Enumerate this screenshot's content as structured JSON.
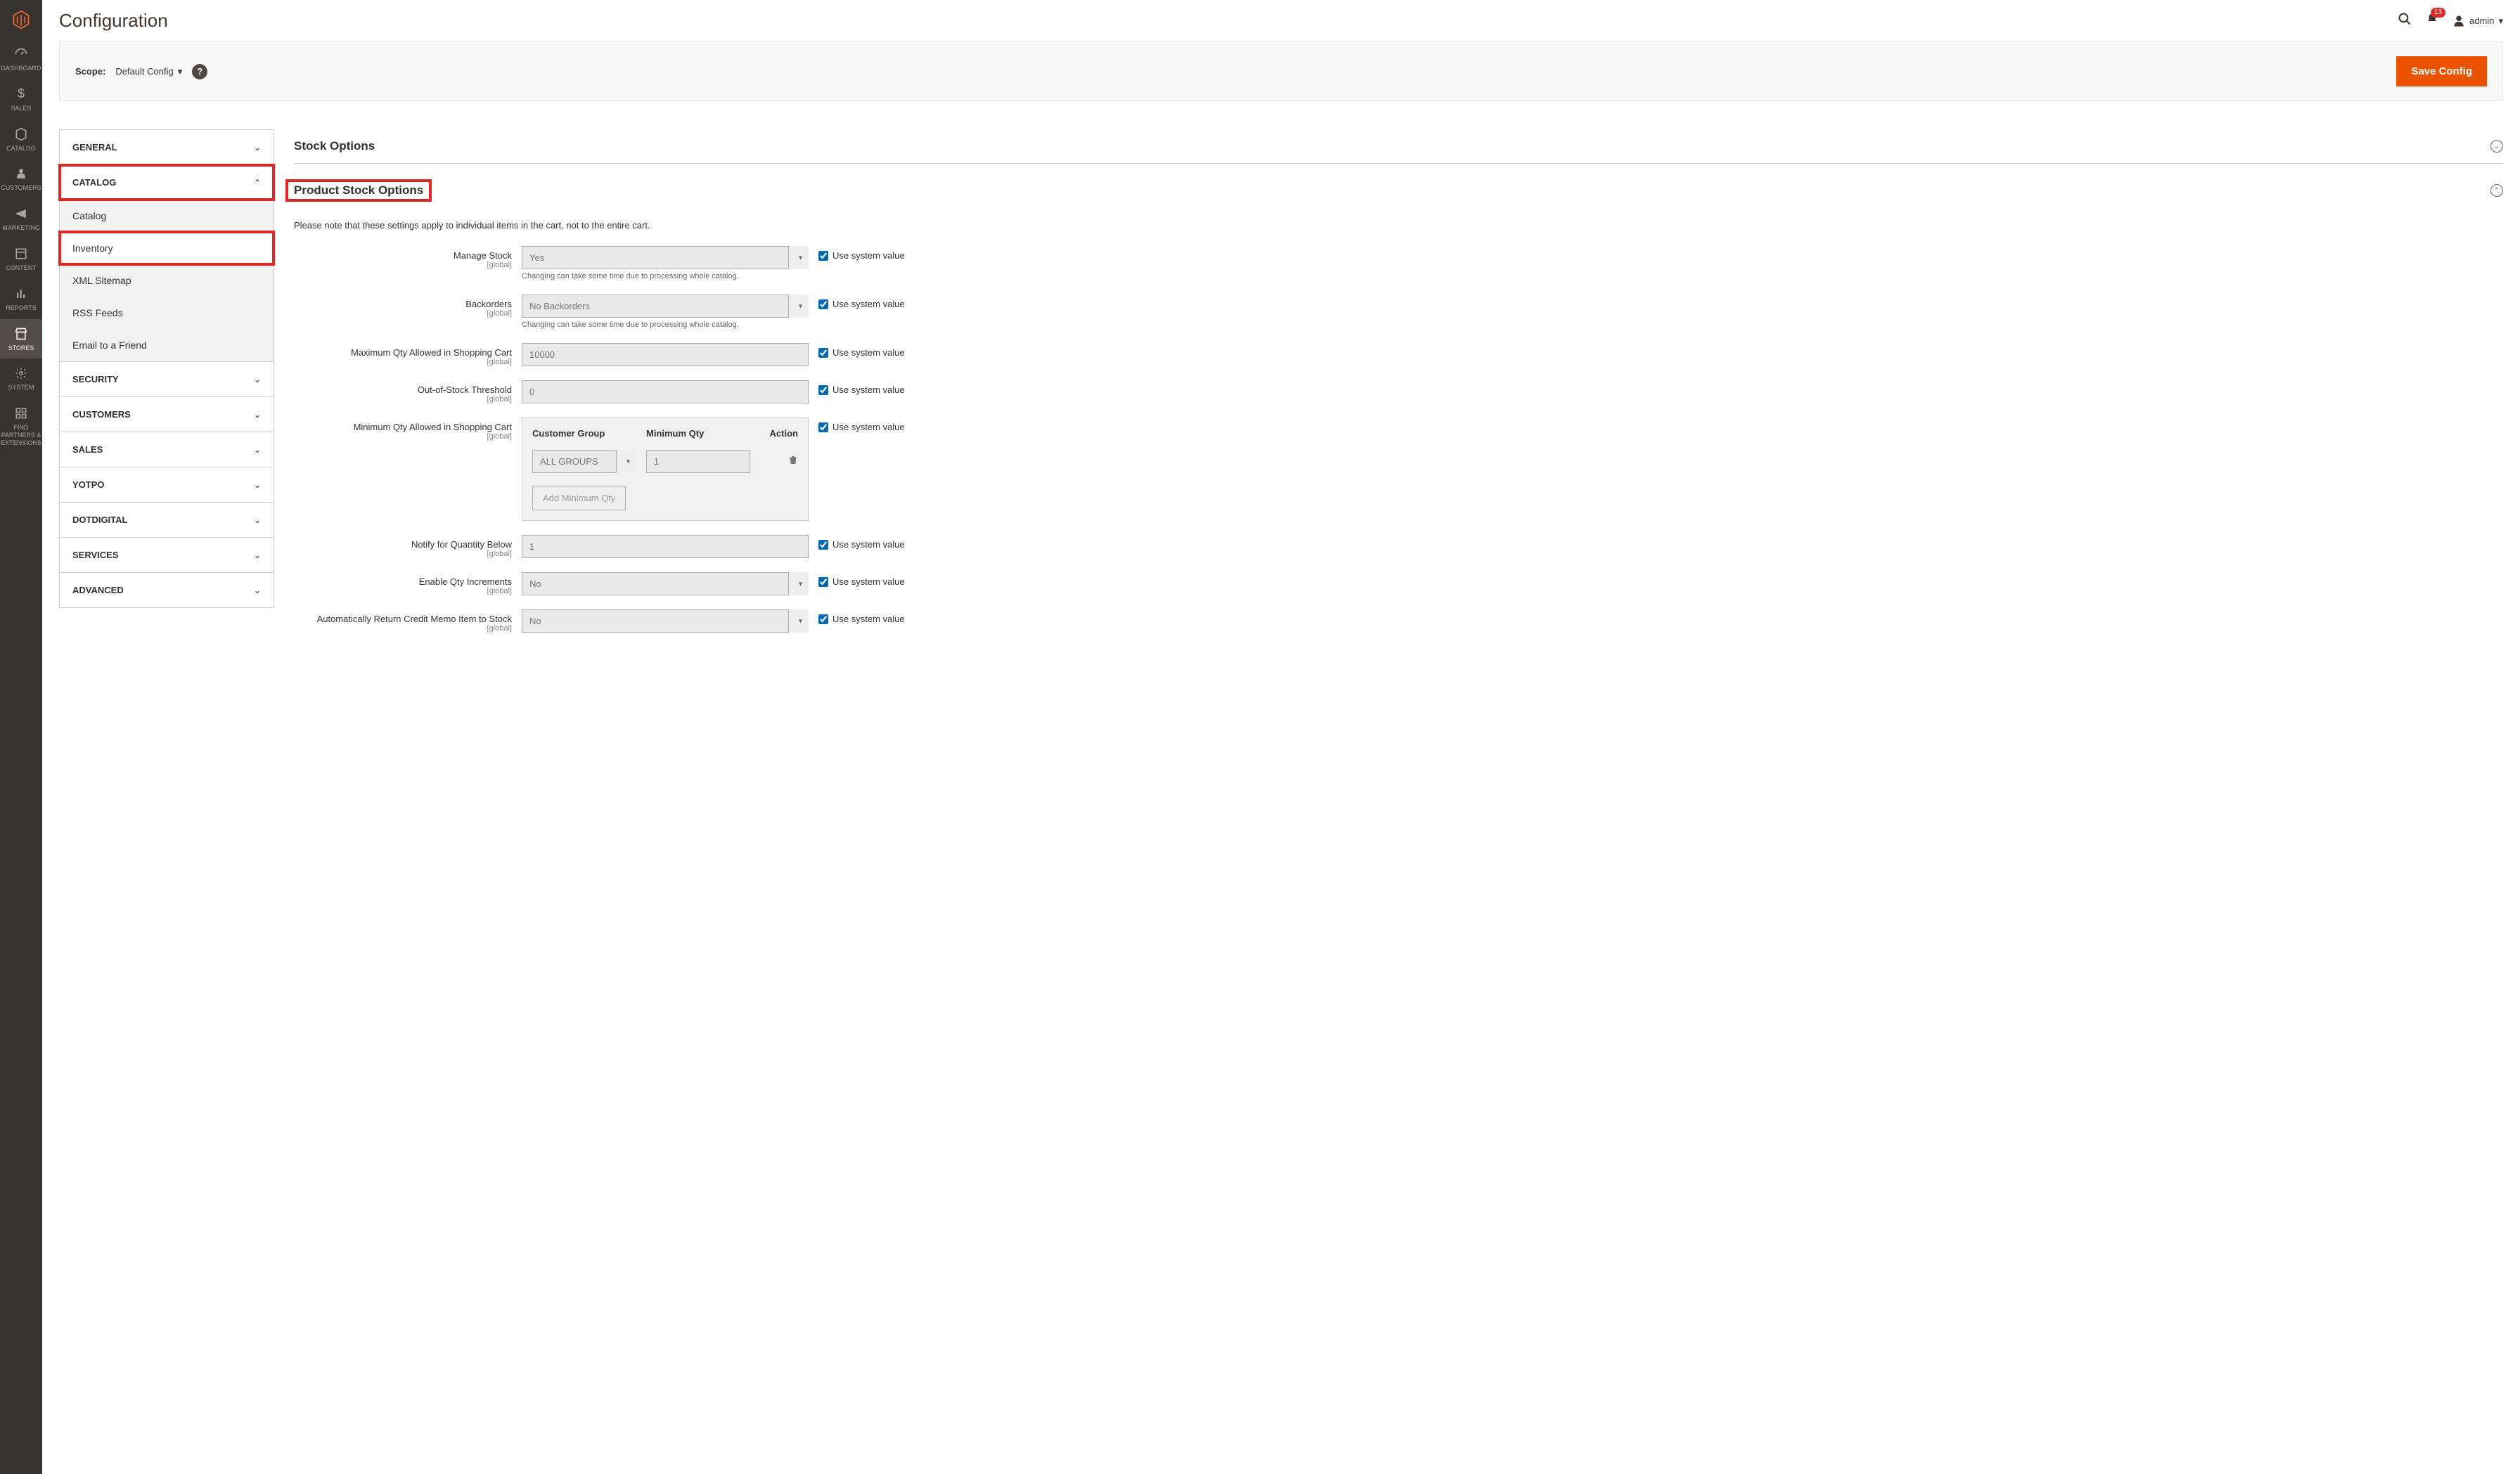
{
  "sidebar": {
    "items": [
      {
        "label": "DASHBOARD"
      },
      {
        "label": "SALES"
      },
      {
        "label": "CATALOG"
      },
      {
        "label": "CUSTOMERS"
      },
      {
        "label": "MARKETING"
      },
      {
        "label": "CONTENT"
      },
      {
        "label": "REPORTS"
      },
      {
        "label": "STORES"
      },
      {
        "label": "SYSTEM"
      },
      {
        "label": "FIND PARTNERS & EXTENSIONS"
      }
    ]
  },
  "header": {
    "title": "Configuration",
    "notifications": "13",
    "user": "admin"
  },
  "scope": {
    "label": "Scope:",
    "value": "Default Config"
  },
  "save_button": "Save Config",
  "tabs": {
    "groups": [
      {
        "label": "GENERAL",
        "open": false
      },
      {
        "label": "CATALOG",
        "open": true,
        "items": [
          {
            "label": "Catalog"
          },
          {
            "label": "Inventory"
          },
          {
            "label": "XML Sitemap"
          },
          {
            "label": "RSS Feeds"
          },
          {
            "label": "Email to a Friend"
          }
        ]
      },
      {
        "label": "SECURITY",
        "open": false
      },
      {
        "label": "CUSTOMERS",
        "open": false
      },
      {
        "label": "SALES",
        "open": false
      },
      {
        "label": "YOTPO",
        "open": false
      },
      {
        "label": "DOTDIGITAL",
        "open": false
      },
      {
        "label": "SERVICES",
        "open": false
      },
      {
        "label": "ADVANCED",
        "open": false
      }
    ]
  },
  "sections": {
    "stock_options": {
      "title": "Stock Options"
    },
    "product_stock": {
      "title": "Product Stock Options",
      "note": "Please note that these settings apply to individual items in the cart, not to the entire cart.",
      "fields": {
        "manage_stock": {
          "label": "Manage Stock",
          "scope": "[global]",
          "value": "Yes",
          "hint": "Changing can take some time due to processing whole catalog."
        },
        "backorders": {
          "label": "Backorders",
          "scope": "[global]",
          "value": "No Backorders",
          "hint": "Changing can take some time due to processing whole catalog."
        },
        "max_qty": {
          "label": "Maximum Qty Allowed in Shopping Cart",
          "scope": "[global]",
          "value": "10000"
        },
        "oos_threshold": {
          "label": "Out-of-Stock Threshold",
          "scope": "[global]",
          "value": "0"
        },
        "min_qty": {
          "label": "Minimum Qty Allowed in Shopping Cart",
          "scope": "[global]",
          "cols": {
            "c1": "Customer Group",
            "c2": "Minimum Qty",
            "c3": "Action"
          },
          "row": {
            "group": "ALL GROUPS",
            "qty": "1"
          },
          "add_btn": "Add Minimum Qty"
        },
        "notify_below": {
          "label": "Notify for Quantity Below",
          "scope": "[global]",
          "value": "1"
        },
        "enable_incr": {
          "label": "Enable Qty Increments",
          "scope": "[global]",
          "value": "No"
        },
        "auto_return": {
          "label": "Automatically Return Credit Memo Item to Stock",
          "scope": "[global]",
          "value": "No"
        }
      },
      "use_system": "Use system value"
    }
  }
}
